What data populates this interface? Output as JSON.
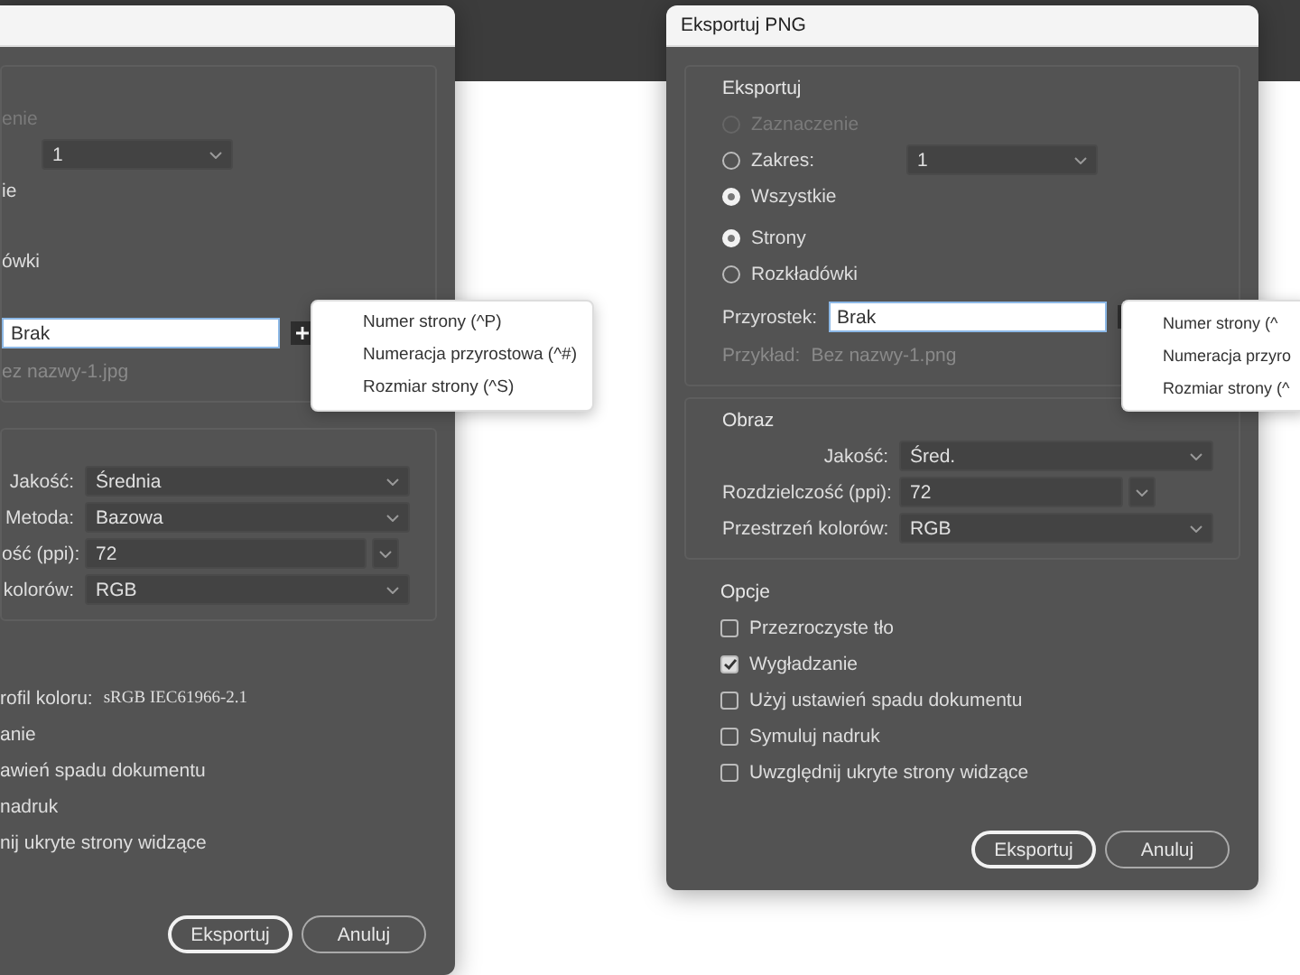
{
  "dialogs": [
    {
      "sections": [
        {
          "kind": "framed",
          "groups": [
            [
              {
                "kind": "text",
                "text": "enie",
                "disabled": true
              },
              {
                "kind": "dropdown",
                "value": "1"
              },
              {
                "kind": "text",
                "text": "ie",
                "disabled": false
              }
            ],
            [
              {
                "kind": "text",
                "text": "ówki",
                "disabled": false
              }
            ],
            [
              {
                "kind": "field",
                "value": "Brak"
              },
              {
                "kind": "hint",
                "text": "ez nazwy-1.jpg"
              }
            ]
          ]
        },
        {
          "kind": "framed",
          "groups": [
            [
              {
                "kind": "select",
                "label": "Jakość:",
                "value": "Średnia"
              },
              {
                "kind": "select",
                "label": "Metoda:",
                "value": "Bazowa"
              },
              {
                "kind": "combo",
                "label": "ość (ppi):",
                "value": "72"
              },
              {
                "kind": "select",
                "label": "kolorów:",
                "value": "RGB"
              }
            ]
          ]
        },
        {
          "kind": "plain",
          "groups": [
            [
              {
                "kind": "pair",
                "label": "rofil koloru:",
                "value": "sRGB IEC61966-2.1"
              },
              {
                "kind": "text",
                "text": "anie",
                "disabled": false
              },
              {
                "kind": "text",
                "text": "awień spadu dokumentu",
                "disabled": false
              },
              {
                "kind": "text",
                "text": "nadruk",
                "disabled": false
              },
              {
                "kind": "text",
                "text": "nij ukryte strony widzące",
                "disabled": false
              }
            ]
          ]
        }
      ],
      "buttons": [
        {
          "label": "Eksportuj",
          "default": true
        },
        {
          "label": "Anuluj",
          "default": false
        }
      ],
      "menu": [
        "Numer strony (^P)",
        "Numeracja przyrostowa (^#)",
        "Rozmiar strony (^S)"
      ]
    },
    {
      "title": "Eksportuj PNG",
      "sections": [
        {
          "kind": "framed",
          "heading": "Eksportuj",
          "groups": [
            [
              {
                "kind": "radio",
                "label": "Zaznaczenie",
                "selected": false,
                "disabled": true
              },
              {
                "kind": "radio",
                "label": "Zakres:",
                "selected": false,
                "disabled": false,
                "value": "1"
              },
              {
                "kind": "radio",
                "label": "Wszystkie",
                "selected": true,
                "disabled": false
              }
            ],
            [
              {
                "kind": "radio",
                "label": "Strony",
                "selected": true,
                "disabled": false
              },
              {
                "kind": "radio",
                "label": "Rozkładówki",
                "selected": false,
                "disabled": false
              }
            ],
            [
              {
                "kind": "field",
                "label": "Przyrostek:",
                "value": "Brak"
              },
              {
                "kind": "hint",
                "label": "Przykład:",
                "text": "Bez nazwy-1.png"
              }
            ]
          ]
        },
        {
          "kind": "framed",
          "heading": "Obraz",
          "groups": [
            [
              {
                "kind": "select",
                "label": "Jakość:",
                "value": "Śred."
              },
              {
                "kind": "combo",
                "label": "Rozdzielczość (ppi):",
                "value": "72"
              },
              {
                "kind": "select",
                "label": "Przestrzeń kolorów:",
                "value": "RGB"
              }
            ]
          ]
        },
        {
          "kind": "plain",
          "heading": "Opcje",
          "groups": [
            [
              {
                "kind": "checkbox",
                "label": "Przezroczyste tło",
                "checked": false
              },
              {
                "kind": "checkbox",
                "label": "Wygładzanie",
                "checked": true
              },
              {
                "kind": "checkbox",
                "label": "Użyj ustawień spadu dokumentu",
                "checked": false
              },
              {
                "kind": "checkbox",
                "label": "Symuluj nadruk",
                "checked": false
              },
              {
                "kind": "checkbox",
                "label": "Uwzględnij ukryte strony widzące",
                "checked": false
              }
            ]
          ]
        }
      ],
      "buttons": [
        {
          "label": "Eksportuj",
          "default": true
        },
        {
          "label": "Anuluj",
          "default": false
        }
      ],
      "menu": [
        "Numer strony (^",
        "Numeracja przyro",
        "Rozmiar strony (^"
      ]
    }
  ]
}
